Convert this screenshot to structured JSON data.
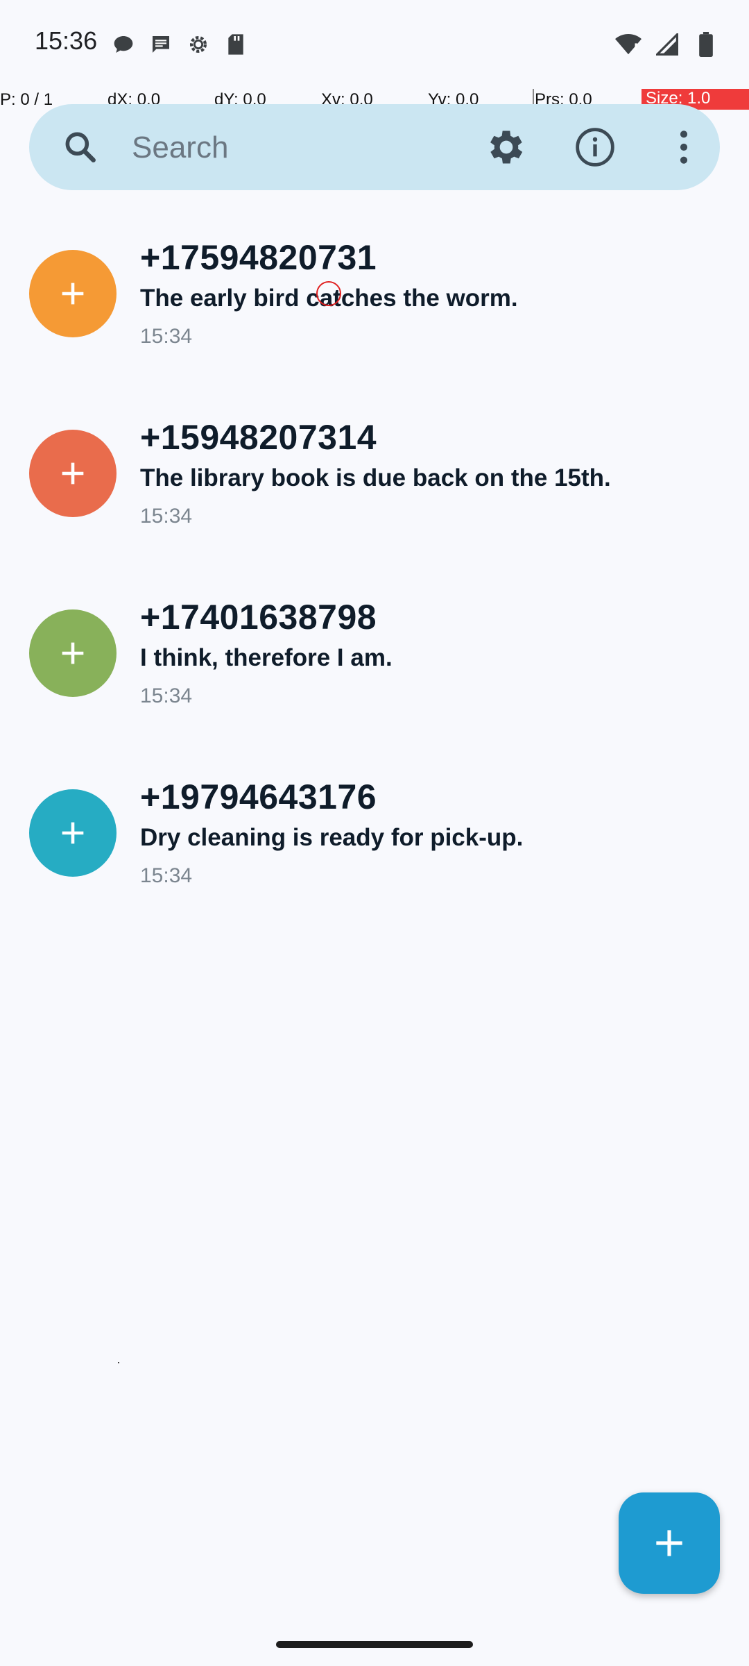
{
  "status_bar": {
    "time": "15:36",
    "left_icons": [
      "chat-bubble-icon",
      "sms-icon",
      "settings-gear-icon",
      "sd-card-icon"
    ],
    "right_icons": [
      "wifi-icon",
      "signal-icon",
      "battery-icon"
    ]
  },
  "debug_bar": {
    "pointer": "P: 0 / 1",
    "dx": "dX: 0.0",
    "dy": "dY: 0.0",
    "xv": "Xv: 0.0",
    "yv": "Yv: 0.0",
    "prs": "Prs: 0.0",
    "size": "Size: 1.0",
    "size_color": "#ef3b3b"
  },
  "search": {
    "placeholder": "Search",
    "icons": [
      "search-icon",
      "settings-icon",
      "info-icon",
      "more-options-icon"
    ]
  },
  "conversations": [
    {
      "title": "+17594820731",
      "message": "The early bird catches the worm.",
      "time": "15:34",
      "avatar_color": "#f59a35"
    },
    {
      "title": "+15948207314",
      "message": "The library book is due back on the 15th.",
      "time": "15:34",
      "avatar_color": "#e96c4c"
    },
    {
      "title": "+17401638798",
      "message": "I think, therefore I am.",
      "time": "15:34",
      "avatar_color": "#88b15a"
    },
    {
      "title": "+19794643176",
      "message": "Dry cleaning is ready for pick-up.",
      "time": "15:34",
      "avatar_color": "#26acc3"
    }
  ],
  "fab": {
    "icon": "plus-icon",
    "color": "#1e9bd1"
  }
}
